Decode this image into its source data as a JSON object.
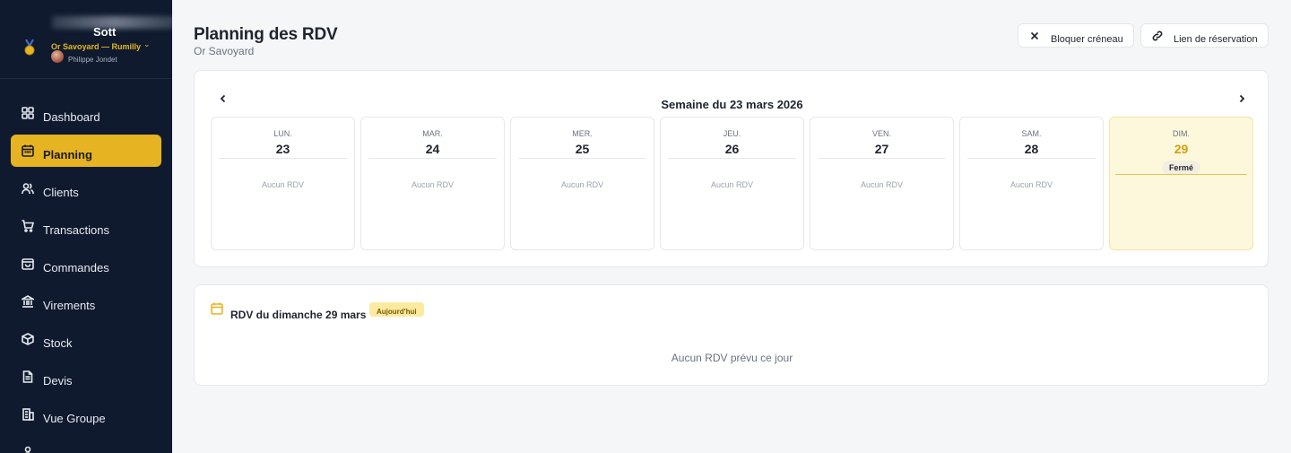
{
  "sidebar": {
    "brand": {
      "name": "Sott",
      "store": "Or Savoyard — Rumilly",
      "user": "Philippe Jondet"
    },
    "items": [
      {
        "label": "Dashboard",
        "icon": "dashboard-icon",
        "active": false
      },
      {
        "label": "Planning",
        "icon": "calendar-icon",
        "active": true
      },
      {
        "label": "Clients",
        "icon": "users-icon",
        "active": false
      },
      {
        "label": "Transactions",
        "icon": "cart-icon",
        "active": false
      },
      {
        "label": "Commandes",
        "icon": "bag-icon",
        "active": false
      },
      {
        "label": "Virements",
        "icon": "bank-icon",
        "active": false
      },
      {
        "label": "Stock",
        "icon": "box-icon",
        "active": false
      },
      {
        "label": "Devis",
        "icon": "document-icon",
        "active": false
      },
      {
        "label": "Vue Groupe",
        "icon": "building-icon",
        "active": false
      }
    ]
  },
  "header": {
    "title": "Planning des RDV",
    "subtitle": "Or Savoyard",
    "block_label": "Bloquer créneau",
    "link_label": "Lien de réservation"
  },
  "week": {
    "title": "Semaine du 23 mars 2026",
    "days": [
      {
        "name": "LUN.",
        "num": "23",
        "status": "Aucun RDV"
      },
      {
        "name": "MAR.",
        "num": "24",
        "status": "Aucun RDV"
      },
      {
        "name": "MER.",
        "num": "25",
        "status": "Aucun RDV"
      },
      {
        "name": "JEU.",
        "num": "26",
        "status": "Aucun RDV"
      },
      {
        "name": "VEN.",
        "num": "27",
        "status": "Aucun RDV"
      },
      {
        "name": "SAM.",
        "num": "28",
        "status": "Aucun RDV"
      },
      {
        "name": "DIM.",
        "num": "29",
        "closed": "Fermé"
      }
    ]
  },
  "detail": {
    "title": "RDV du dimanche 29 mars",
    "badge": "Aujourd'hui",
    "empty": "Aucun RDV prévu ce jour"
  },
  "colors": {
    "accent": "#e6b422",
    "sidebar": "#0f1a2e",
    "today_bg": "#fdf8dc"
  }
}
